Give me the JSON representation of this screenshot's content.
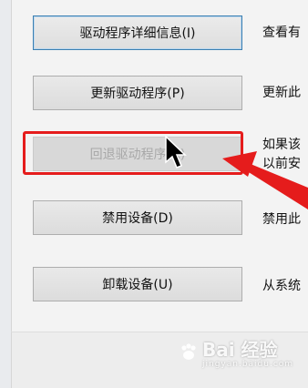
{
  "buttons": [
    {
      "label": "驱动程序详细信息(I)",
      "description": "查看有"
    },
    {
      "label": "更新驱动程序(P)",
      "description": "更新此"
    },
    {
      "label": "回退驱动程序(R)",
      "description_line1": "如果该",
      "description_line2": "以前安"
    },
    {
      "label": "禁用设备(D)",
      "description": "禁用此"
    },
    {
      "label": "卸载设备(U)",
      "description": "从系统"
    }
  ],
  "annotation": {
    "highlight_color": "#e51c1c",
    "arrow_color": "#e51c1c"
  },
  "watermark": {
    "brand": "Bai 经验",
    "sub": "jingyan.baidu.com"
  }
}
